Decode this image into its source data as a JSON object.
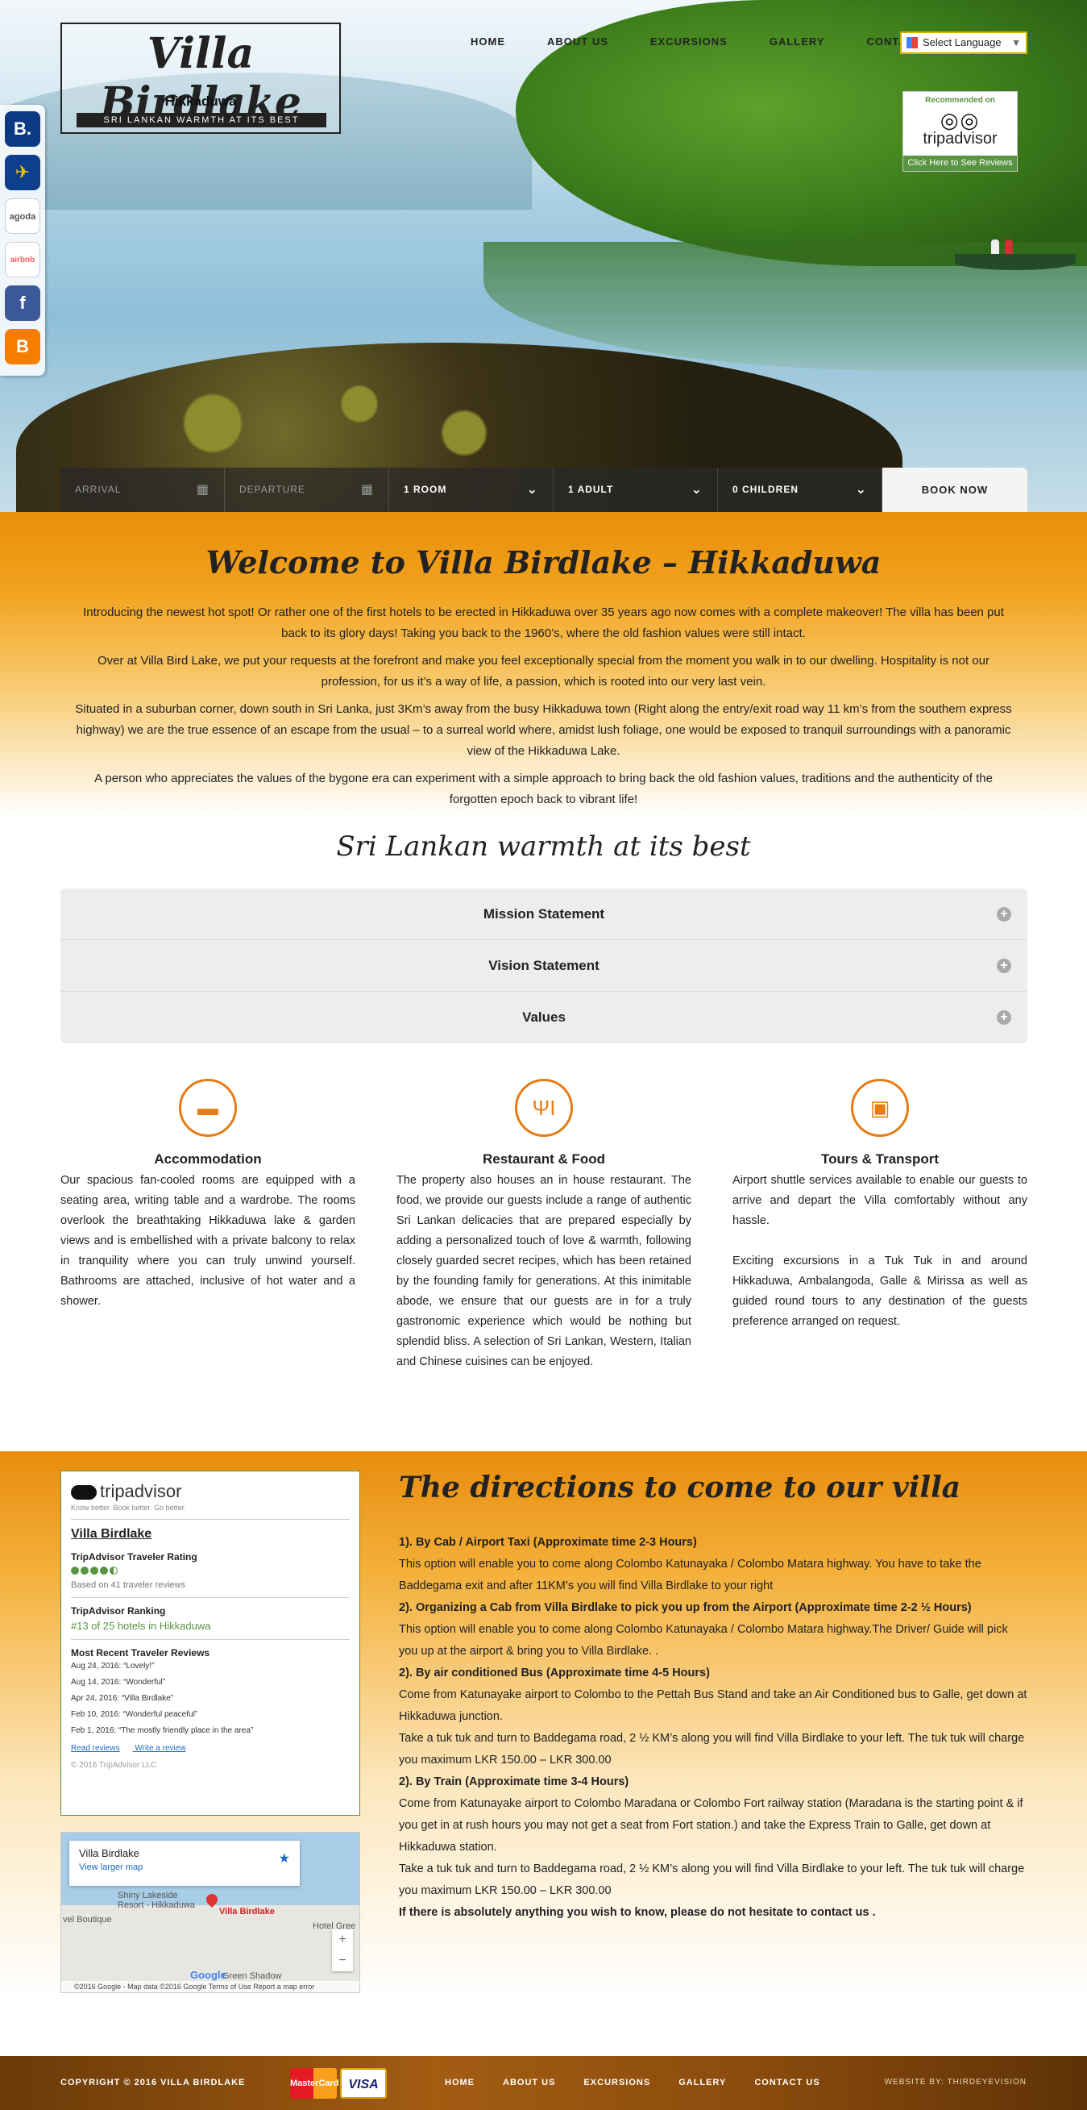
{
  "header": {
    "logo": {
      "name": "Villa Birdlake",
      "city": "Hikkaduwa",
      "tagline": "SRI LANKAN WARMTH AT ITS BEST"
    },
    "nav": [
      "HOME",
      "ABOUT US",
      "EXCURSIONS",
      "GALLERY",
      "CONTACT"
    ],
    "language_select": "Select Language",
    "tripadvisor_badge": {
      "recommended": "Recommended on",
      "brand": "tripadvisor",
      "cta": "Click Here to See Reviews"
    }
  },
  "social": [
    "booking-icon",
    "expedia-icon",
    "agoda-icon",
    "airbnb-icon",
    "facebook-icon",
    "blogger-icon"
  ],
  "social_text": {
    "booking": "B.",
    "agoda": "agoda",
    "airbnb": "airbnb"
  },
  "booking_bar": {
    "arrival": "ARRIVAL",
    "departure": "DEPARTURE",
    "rooms": "1 ROOM",
    "adults": "1 ADULT",
    "children": "0 CHILDREN",
    "book_now": "BOOK NOW"
  },
  "welcome": {
    "title": "Welcome to Villa Birdlake – Hikkaduwa",
    "paragraphs": [
      "Introducing the newest hot spot! Or rather one of the first hotels to be erected in Hikkaduwa over 35 years ago now comes with a complete makeover! The villa has been put back to its glory days! Taking you back to the 1960’s, where the old fashion values were still intact.",
      "Over at Villa Bird Lake, we put your requests at the forefront and make you feel exceptionally special from the moment you walk in to our dwelling. Hospitality is not our profession, for us it’s a way of life, a passion, which is rooted into our very last vein.",
      "Situated in a suburban corner, down south in Sri Lanka, just 3Km’s away from the busy Hikkaduwa town (Right along the entry/exit road way 11 km’s from the southern express highway) we are the true essence of an escape from the usual – to a surreal world where, amidst lush foliage, one would be exposed to tranquil surroundings with a panoramic view of the Hikkaduwa Lake.",
      "A person who appreciates the values of the bygone era can experiment with a simple approach to bring back the old fashion values, traditions and the authenticity of the forgotten epoch back to vibrant life!"
    ]
  },
  "tagline": "Sri Lankan warmth at its best",
  "accordion": [
    "Mission Statement",
    "Vision Statement",
    "Values"
  ],
  "features": [
    {
      "icon": "bed-icon",
      "title": "Accommodation",
      "text": "Our spacious fan-cooled rooms are equipped with a seating area, writing table and a wardrobe. The rooms overlook the breathtaking Hikkaduwa lake & garden views and is embellished with a private balcony to relax in tranquility where you can truly unwind yourself. Bathrooms are attached, inclusive of hot water and a shower."
    },
    {
      "icon": "cutlery-icon",
      "title": "Restaurant & Food",
      "text": "The property also houses an in house restaurant. The food, we provide our guests include a range of authentic Sri Lankan delicacies that are prepared especially by adding a personalized touch of love & warmth, following closely guarded secret recipes, which has been retained by the founding family for generations. At this inimitable abode, we ensure that our guests are in for a truly gastronomic experience which would be nothing but splendid bliss. A selection of Sri Lankan, Western, Italian and Chinese cuisines can be enjoyed."
    },
    {
      "icon": "taxi-icon",
      "title": "Tours & Transport",
      "text": "Airport shuttle services available to enable our guests to arrive and depart the Villa comfortably without any hassle.\n\nExciting excursions in a Tuk Tuk in and around Hikkaduwa, Ambalangoda, Galle & Mirissa as well as guided round tours to any destination of the guests preference arranged on request."
    }
  ],
  "tripadvisor_widget": {
    "brand": "tripadvisor",
    "slogan": "Know better. Book better. Go better.",
    "hotel": "Villa Birdlake",
    "rating_label": "TripAdvisor Traveler Rating",
    "rating_bubbles": 4.5,
    "based_on": "Based on 41 traveler reviews",
    "ranking_label": "TripAdvisor Ranking",
    "ranking": "#13 of 25 hotels in Hikkaduwa",
    "reviews_label": "Most Recent Traveler Reviews",
    "reviews": [
      "Aug 24, 2016: “Lovely!”",
      "Aug 14, 2016: “Wonderful”",
      "Apr 24, 2016: “Villa Birdlake”",
      "Feb 10, 2016: “Wonderful peaceful”",
      "Feb 1, 2016: “The mostly friendly place in the area”"
    ],
    "read_reviews": "Read reviews",
    "write_review": "Write a review",
    "copyright": "© 2016 TripAdvisor LLC"
  },
  "map": {
    "place": "Villa Birdlake",
    "larger": "View larger map",
    "pin_label": "Villa Birdlake",
    "labels": [
      "Shiny Lakeside Resort - Hikkaduwa",
      "vel Boutique",
      "Hotel Gree",
      "Green Shadow"
    ],
    "google": "Google",
    "footer": "©2016 Google - Map data ©2016 Google   Terms of Use   Report a map error"
  },
  "directions": {
    "title": "The directions to come to our villa",
    "blocks": [
      {
        "heading": "1). By Cab / Airport Taxi (Approximate time 2-3 Hours)",
        "text": "This option will enable you to come along Colombo Katunayaka / Colombo Matara highway. You have to take the Baddegama exit and after 11KM’s you will find Villa Birdlake to your right"
      },
      {
        "heading": "2). Organizing a Cab from Villa Birdlake to pick you up from the Airport (Approximate time 2-2 ½ Hours)",
        "text": "This option will enable you to come along Colombo Katunayaka / Colombo Matara highway.The Driver/ Guide will pick you up at the airport & bring you to Villa Birdlake. ."
      },
      {
        "heading": "2). By air conditioned Bus (Approximate time 4-5 Hours)",
        "text": "Come from Katunayake airport to Colombo to the Pettah Bus Stand and take an Air Conditioned bus to Galle, get down at Hikkaduwa junction.\nTake a tuk tuk and turn to Baddegama road, 2 ½ KM’s along you will find Villa Birdlake to your left. The tuk tuk will charge you maximum LKR 150.00 – LKR 300.00"
      },
      {
        "heading": "2). By Train (Approximate time 3-4 Hours)",
        "text": "Come from Katunayake airport to Colombo Maradana or Colombo Fort railway station (Maradana is the starting point & if you get in at rush hours you may not get a seat from Fort station.) and take the Express Train to Galle, get down at Hikkaduwa station.\nTake a tuk tuk and turn to Baddegama road, 2 ½ KM’s along you will find Villa Birdlake to your left. The tuk tuk will charge you maximum LKR 150.00 – LKR 300.00"
      }
    ],
    "closing": "If there is absolutely anything you wish to know, please do not hesitate to contact us ."
  },
  "footer": {
    "copyright": "COPYRIGHT © 2016 VILLA BIRDLAKE",
    "cards": [
      "MasterCard",
      "VISA"
    ],
    "nav": [
      "HOME",
      "ABOUT US",
      "EXCURSIONS",
      "GALLERY",
      "CONTACT US"
    ],
    "credit": "WEBSITE BY: THIRDEYEVISION"
  }
}
